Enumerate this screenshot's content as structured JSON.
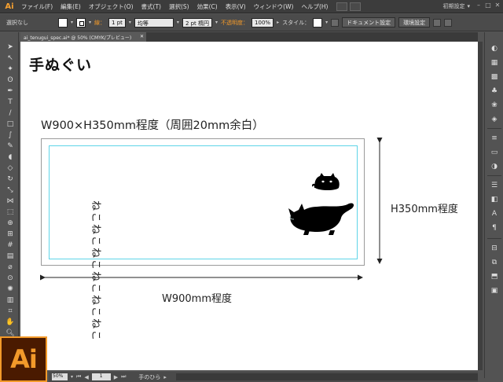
{
  "app": {
    "logo_text": "Ai"
  },
  "menu": {
    "items": [
      "ファイル(F)",
      "編集(E)",
      "オブジェクト(O)",
      "書式(T)",
      "選択(S)",
      "効果(C)",
      "表示(V)",
      "ウィンドウ(W)",
      "ヘルプ(H)"
    ],
    "workspace": "初期設定"
  },
  "control": {
    "selection": "選択なし",
    "stroke_label": "線：",
    "stroke_weight": "1 pt",
    "profile": "均等",
    "brush": "2 pt 楕円",
    "opacity_label": "不透明度：",
    "opacity_value": "100%",
    "style_label": "スタイル：",
    "doc_settings": "ドキュメント設定",
    "preferences": "環境設定"
  },
  "document": {
    "tab_title": "ai_tenugui_spec.ai* @ 50% (CMYK/プレビュー)"
  },
  "artwork": {
    "title": "手ぬぐい",
    "spec": "W900×H350mm程度（周囲20mm余白）",
    "tenugui_text": "ねこねこねこねこねこねこ",
    "height_label": "H350mm程度",
    "width_label": "W900mm程度"
  },
  "status": {
    "zoom": "50%",
    "page": "1",
    "tool": "手のひら"
  },
  "colors": {
    "accent": "#f39a2a",
    "bleed_guide": "#5ed4e8",
    "chrome_dark": "#3c3c3c",
    "chrome": "#535353"
  }
}
